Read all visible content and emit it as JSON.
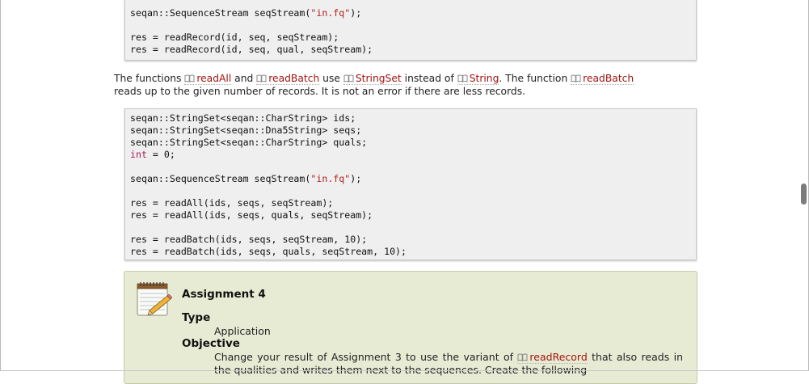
{
  "code_block_1": {
    "lines": [
      {
        "parts": [
          {
            "t": "seqan::SequenceStream seqStream(",
            "c": ""
          },
          {
            "t": "\"in.fq\"",
            "c": "str"
          },
          {
            "t": ");",
            "c": ""
          }
        ]
      },
      {
        "parts": []
      },
      {
        "parts": [
          {
            "t": "res = readRecord(id, seq, seqStream);",
            "c": ""
          }
        ]
      },
      {
        "parts": [
          {
            "t": "res = readRecord(id, seq, qual, seqStream);",
            "c": ""
          }
        ]
      }
    ]
  },
  "prose": {
    "t1": "The functions ",
    "readAll": "readAll",
    "t2": " and ",
    "readBatch": "readBatch",
    "t3": " use ",
    "StringSet": "StringSet",
    "t4": " instead of ",
    "String": "String",
    "t5": ". The function ",
    "readBatch2": "readBatch",
    "t6": "reads up to the given number of records. It is not an error if there are less records."
  },
  "code_block_2": {
    "lines": [
      {
        "parts": [
          {
            "t": "seqan::StringSet<seqan::CharString> ids;",
            "c": ""
          }
        ]
      },
      {
        "parts": [
          {
            "t": "seqan::StringSet<seqan::Dna5String> seqs;",
            "c": ""
          }
        ]
      },
      {
        "parts": [
          {
            "t": "seqan::StringSet<seqan::CharString> quals;",
            "c": ""
          }
        ]
      },
      {
        "parts": [
          {
            "t": "int",
            "c": "kw"
          },
          {
            "t": " = 0;",
            "c": ""
          }
        ]
      },
      {
        "parts": []
      },
      {
        "parts": [
          {
            "t": "seqan::SequenceStream seqStream(",
            "c": ""
          },
          {
            "t": "\"in.fq\"",
            "c": "str"
          },
          {
            "t": ");",
            "c": ""
          }
        ]
      },
      {
        "parts": []
      },
      {
        "parts": [
          {
            "t": "res = readAll(ids, seqs, seqStream);",
            "c": ""
          }
        ]
      },
      {
        "parts": [
          {
            "t": "res = readAll(ids, seqs, quals, seqStream);",
            "c": ""
          }
        ]
      },
      {
        "parts": []
      },
      {
        "parts": [
          {
            "t": "res = readBatch(ids, seqs, seqStream, 10);",
            "c": ""
          }
        ]
      },
      {
        "parts": [
          {
            "t": "res = readBatch(ids, seqs, quals, seqStream, 10);",
            "c": ""
          }
        ]
      }
    ]
  },
  "assignment": {
    "title": "Assignment 4",
    "type_heading": "Type",
    "type_value": "Application",
    "objective_heading": "Objective",
    "objective_pre": "Change your result of Assignment 3 to use the variant of ",
    "objective_link": "readRecord",
    "objective_post": " that also reads in the qualities and writes them next to the sequences. Create the following"
  },
  "colors": {
    "link": "#a0140f",
    "string_literal": "#b52121",
    "keyword": "#a71d5d",
    "assignment_bg": "#e8ebd4"
  },
  "icons": {
    "reference": "book-icon",
    "assignment": "notepad-icon"
  }
}
